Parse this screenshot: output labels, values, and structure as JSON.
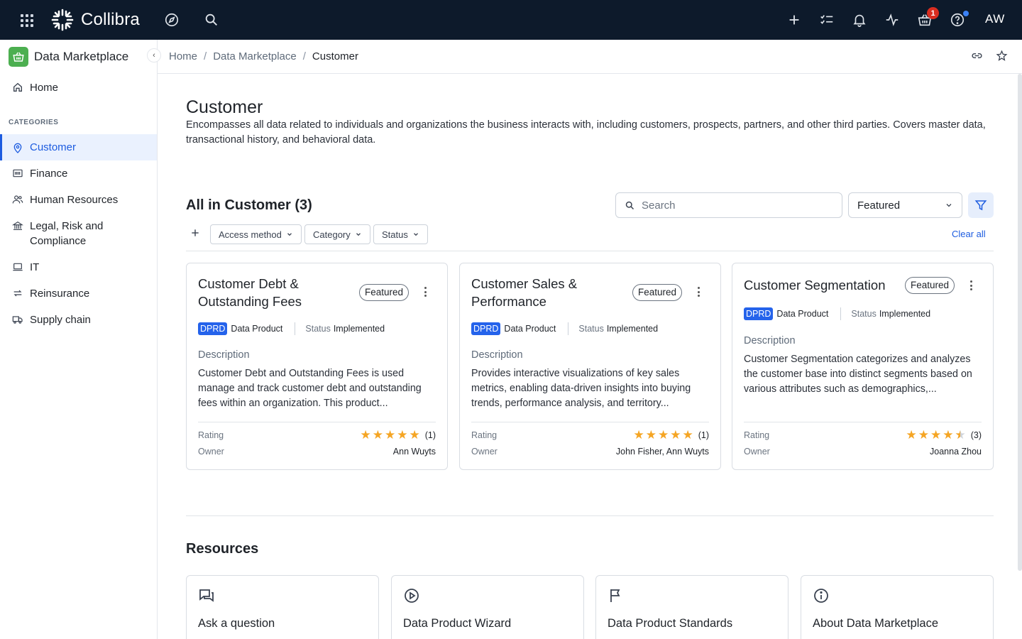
{
  "topbar": {
    "brand": "Collibra",
    "notification_count": "1",
    "avatar_initials": "AW"
  },
  "sidebar": {
    "title": "Data Marketplace",
    "home_label": "Home",
    "section_label": "CATEGORIES",
    "categories": [
      {
        "label": "Customer",
        "icon": "location-pin-icon",
        "active": true
      },
      {
        "label": "Finance",
        "icon": "finance-icon"
      },
      {
        "label": "Human Resources",
        "icon": "people-icon"
      },
      {
        "label": "Legal, Risk and Compliance",
        "icon": "bank-icon"
      },
      {
        "label": "IT",
        "icon": "laptop-icon"
      },
      {
        "label": "Reinsurance",
        "icon": "repeat-icon"
      },
      {
        "label": "Supply chain",
        "icon": "truck-icon"
      }
    ]
  },
  "breadcrumb": {
    "items": [
      "Home",
      "Data Marketplace",
      "Customer"
    ],
    "separator": "/"
  },
  "page": {
    "title": "Customer",
    "description": "Encompasses all data related to individuals and organizations the business interacts with, including customers, prospects, partners, and other third parties. Covers master data, transactional history, and behavioral data."
  },
  "listing": {
    "title": "All in Customer (3)",
    "search_placeholder": "Search",
    "sort_value": "Featured",
    "filters": [
      "Access method",
      "Category",
      "Status"
    ],
    "clear_all": "Clear all"
  },
  "cards": [
    {
      "title": "Customer Debt & Outstanding Fees",
      "badge": "Featured",
      "type_code": "DPRD",
      "type_label": "Data Product",
      "status_label": "Status",
      "status_value": "Implemented",
      "description_label": "Description",
      "description": "Customer Debt and Outstanding Fees is used manage and track customer debt and outstanding fees within an organization. This product...",
      "rating_label": "Rating",
      "rating": 5,
      "rating_count": "(1)",
      "owner_label": "Owner",
      "owner": "Ann Wuyts"
    },
    {
      "title": "Customer Sales & Performance",
      "badge": "Featured",
      "type_code": "DPRD",
      "type_label": "Data Product",
      "status_label": "Status",
      "status_value": "Implemented",
      "description_label": "Description",
      "description": "Provides interactive visualizations of key sales metrics, enabling data-driven insights into buying trends, performance analysis, and territory...",
      "rating_label": "Rating",
      "rating": 5,
      "rating_count": "(1)",
      "owner_label": "Owner",
      "owner": "John Fisher, Ann Wuyts"
    },
    {
      "title": "Customer Segmentation",
      "badge": "Featured",
      "type_code": "DPRD",
      "type_label": "Data Product",
      "status_label": "Status",
      "status_value": "Implemented",
      "description_label": "Description",
      "description": "Customer Segmentation categorizes and analyzes the customer base into distinct segments based on various attributes such as demographics,...",
      "rating_label": "Rating",
      "rating": 4.5,
      "rating_count": "(3)",
      "owner_label": "Owner",
      "owner": "Joanna Zhou"
    }
  ],
  "resources": {
    "title": "Resources",
    "items": [
      {
        "label": "Ask a question",
        "icon": "chat-icon"
      },
      {
        "label": "Data Product Wizard",
        "icon": "play-circle-icon"
      },
      {
        "label": "Data Product Standards",
        "icon": "flag-icon"
      },
      {
        "label": "About Data Marketplace",
        "icon": "info-icon"
      }
    ]
  }
}
